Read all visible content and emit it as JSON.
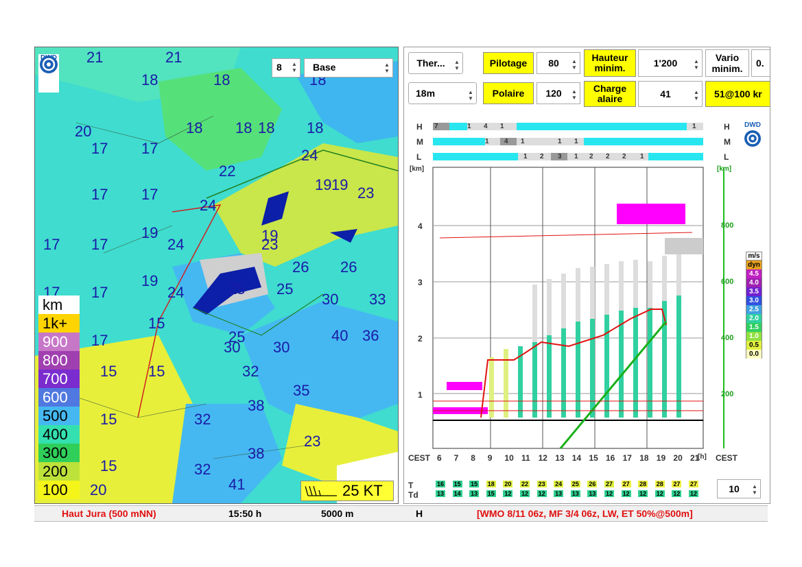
{
  "map": {
    "altitude_value": "8",
    "level_select": "Base",
    "dwd_logo": "DWD",
    "wind_key": "25 KT",
    "temperatures": [
      {
        "t": "21"
      },
      {
        "t": "21"
      },
      {
        "t": "18"
      },
      {
        "t": "18"
      },
      {
        "t": "18"
      },
      {
        "t": "20"
      },
      {
        "t": "17"
      },
      {
        "t": "17"
      },
      {
        "t": "18"
      },
      {
        "t": "18"
      },
      {
        "t": "18"
      },
      {
        "t": "18"
      },
      {
        "t": "22"
      },
      {
        "t": "24"
      },
      {
        "t": "17"
      },
      {
        "t": "17"
      },
      {
        "t": "19"
      },
      {
        "t": "19"
      },
      {
        "t": "23"
      },
      {
        "t": "24"
      },
      {
        "t": "17"
      },
      {
        "t": "17"
      },
      {
        "t": "19"
      },
      {
        "t": "24"
      },
      {
        "t": "19"
      },
      {
        "t": "23"
      },
      {
        "t": "26"
      },
      {
        "t": "26"
      },
      {
        "t": "17"
      },
      {
        "t": "17"
      },
      {
        "t": "19"
      },
      {
        "t": "24"
      },
      {
        "t": "25"
      },
      {
        "t": "25"
      },
      {
        "t": "30"
      },
      {
        "t": "33"
      },
      {
        "t": "15"
      },
      {
        "t": "17"
      },
      {
        "t": "25"
      },
      {
        "t": "30"
      },
      {
        "t": "30"
      },
      {
        "t": "40"
      },
      {
        "t": "36"
      },
      {
        "t": "15"
      },
      {
        "t": "15"
      },
      {
        "t": "32"
      },
      {
        "t": "35"
      },
      {
        "t": "15"
      },
      {
        "t": "38"
      },
      {
        "t": "32"
      },
      {
        "t": "23"
      },
      {
        "t": "15"
      },
      {
        "t": "38"
      },
      {
        "t": "20"
      },
      {
        "t": "32"
      },
      {
        "t": "41"
      }
    ],
    "legend": [
      {
        "label": "km",
        "color": "#ffffff",
        "text": "#000000"
      },
      {
        "label": "1k+",
        "color": "#ffd400",
        "text": "#000000"
      },
      {
        "label": "900",
        "color": "#c777c7",
        "text": "#ffffff"
      },
      {
        "label": "800",
        "color": "#a03fb0",
        "text": "#ffffff"
      },
      {
        "label": "700",
        "color": "#7a2ccf",
        "text": "#ffffff"
      },
      {
        "label": "600",
        "color": "#4f78e0",
        "text": "#ffffff"
      },
      {
        "label": "500",
        "color": "#45b8f2",
        "text": "#000000"
      },
      {
        "label": "400",
        "color": "#34e0b0",
        "text": "#000000"
      },
      {
        "label": "300",
        "color": "#2fcf5a",
        "text": "#000000"
      },
      {
        "label": "200",
        "color": "#bde23a",
        "text": "#000000"
      },
      {
        "label": "100",
        "color": "#f5f51a",
        "text": "#000000"
      }
    ]
  },
  "controls": {
    "type_select": "Ther...",
    "wing_select": "18m",
    "pilotage_label": "Pilotage",
    "pilotage_value": "80",
    "polaire_label": "Polaire",
    "polaire_value": "120",
    "hauteur_label_1": "Hauteur",
    "hauteur_label_2": "minim.",
    "hauteur_value": "1'200",
    "charge_label_1": "Charge",
    "charge_label_2": "alaire",
    "charge_value": "41",
    "vario_label_1": "Vario",
    "vario_label_2": "minim.",
    "vario_value": "0.",
    "ratio_label": "51@100 kr",
    "bottom_spin": "10"
  },
  "meteogram": {
    "layers": [
      "H",
      "M",
      "L"
    ],
    "layer_right": [
      "H",
      "M",
      "L"
    ],
    "cloud_numbers_h": [
      "7",
      "1",
      "4",
      "1",
      "1"
    ],
    "cloud_numbers_m": [
      "1",
      "4",
      "1",
      "1",
      "1"
    ],
    "cloud_numbers_l": [
      "1",
      "2",
      "3",
      "1",
      "2",
      "2",
      "2",
      "1"
    ],
    "km_unit": "[km]",
    "km_axis": [
      "4",
      "3",
      "2",
      "1"
    ],
    "ft_unit": "[km]",
    "right_axis": [
      "800",
      "600",
      "400",
      "200"
    ],
    "hours": [
      "6",
      "7",
      "8",
      "9",
      "10",
      "11",
      "12",
      "13",
      "14",
      "15",
      "16",
      "17",
      "18",
      "19",
      "20",
      "21"
    ],
    "hour_unit": "[h]",
    "cest": "CEST",
    "ms_label": "m/s",
    "ms_scale": [
      {
        "v": "dyn",
        "c": "#e6a020"
      },
      {
        "v": "4.5",
        "c": "#c020c0"
      },
      {
        "v": "4.0",
        "c": "#a020b0"
      },
      {
        "v": "3.5",
        "c": "#7020d0"
      },
      {
        "v": "3.0",
        "c": "#3050e0"
      },
      {
        "v": "2.5",
        "c": "#40a0e0"
      },
      {
        "v": "2.0",
        "c": "#30d0a0"
      },
      {
        "v": "1.5",
        "c": "#30d060"
      },
      {
        "v": "1.0",
        "c": "#90e040"
      },
      {
        "v": "0.5",
        "c": "#e0f040"
      },
      {
        "v": "0.0",
        "c": "#ffffc0"
      }
    ],
    "T_label": "T",
    "Td_label": "Td",
    "T_values": [
      "16",
      "15",
      "15",
      "18",
      "20",
      "22",
      "23",
      "24",
      "25",
      "26",
      "27",
      "27",
      "28",
      "28",
      "27",
      "27"
    ],
    "Td_values": [
      "13",
      "14",
      "13",
      "15",
      "12",
      "12",
      "12",
      "13",
      "13",
      "13",
      "12",
      "12",
      "12",
      "12",
      "12",
      "12"
    ],
    "dwd": "DWD"
  },
  "status": {
    "location": "Haut Jura (500 mNN)",
    "time": "15:50 h",
    "height": "5000 m",
    "mode": "H",
    "models": "[WMO 8/11 06z, MF 3/4 06z, LW, ET  50%@500m]"
  }
}
